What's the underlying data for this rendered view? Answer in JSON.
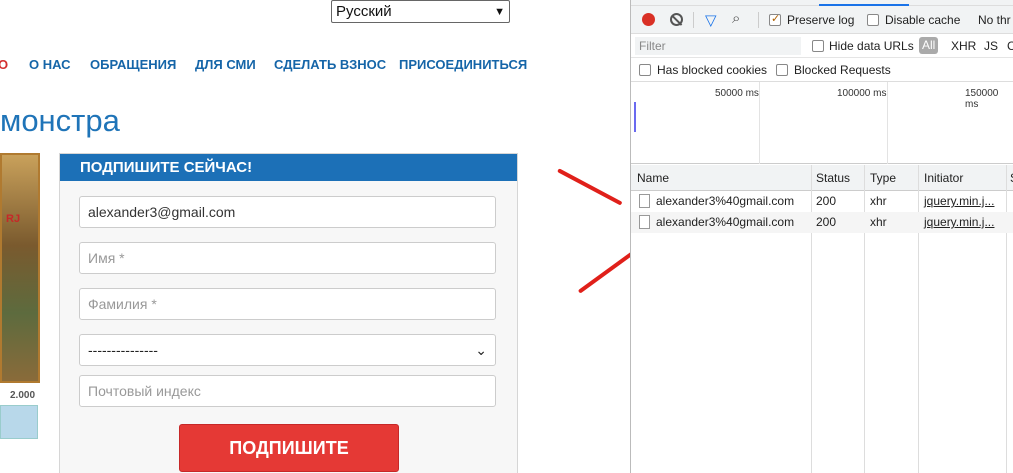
{
  "site": {
    "language": "Русский",
    "nav": [
      "О",
      "О НАС",
      "ОБРАЩЕНИЯ",
      "ДЛЯ СМИ",
      "СДЕЛАТЬ ВЗНОС",
      "ПРИСОЕДИНИТЬСЯ"
    ],
    "headline": "монстра",
    "icon_text": "RJ",
    "progress_value": "2.000",
    "form": {
      "heading": "ПОДПИШИТЕ СЕЙЧАС!",
      "email": "alexander3@gmail.com",
      "first_name_placeholder": "Имя *",
      "last_name_placeholder": "Фамилия *",
      "select_value": "---------------",
      "zip_placeholder": "Почтовый индекс",
      "submit": "ПОДПИШИТЕ"
    }
  },
  "devtools": {
    "preserve_log": "Preserve log",
    "disable_cache": "Disable cache",
    "throttling": "No thr",
    "filter_placeholder": "Filter",
    "hide_data_urls": "Hide data URLs",
    "type_filters": [
      "All",
      "XHR",
      "JS",
      "C"
    ],
    "has_blocked_cookies": "Has blocked cookies",
    "blocked_requests": "Blocked Requests",
    "timeline_labels": [
      "50000 ms",
      "100000 ms",
      "150000 ms"
    ],
    "columns": [
      "Name",
      "Status",
      "Type",
      "Initiator",
      "S"
    ],
    "rows": [
      {
        "name": "alexander3%40gmail.com",
        "status": "200",
        "type": "xhr",
        "initiator": "jquery.min.j..."
      },
      {
        "name": "alexander3%40gmail.com",
        "status": "200",
        "type": "xhr",
        "initiator": "jquery.min.j..."
      }
    ]
  },
  "colors": {
    "accent_red": "#e0201a",
    "brand_blue": "#1c70b7"
  }
}
